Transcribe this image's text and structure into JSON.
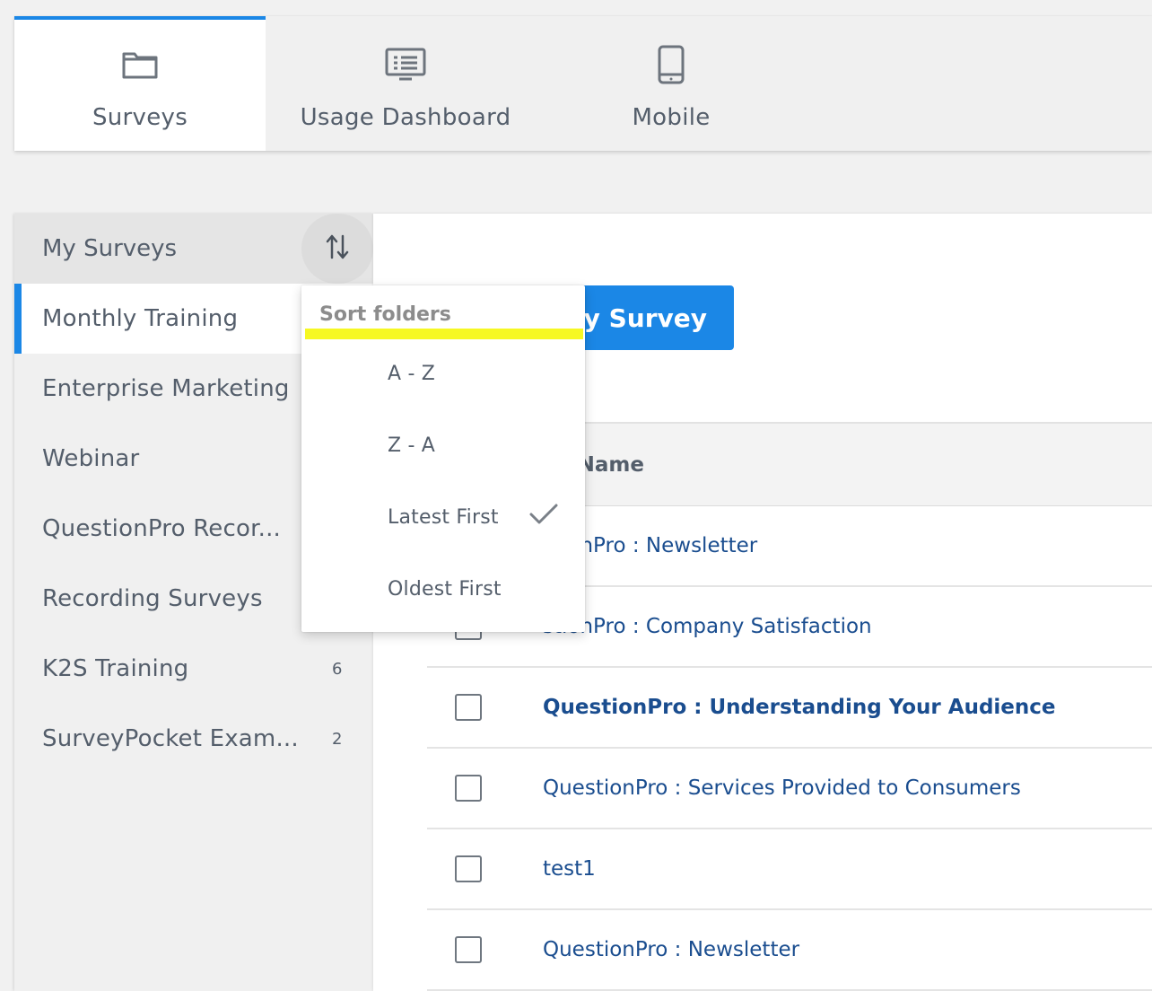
{
  "nav": {
    "tabs": [
      {
        "label": "Surveys",
        "icon": "folder-icon"
      },
      {
        "label": "Usage Dashboard",
        "icon": "dashboard-icon"
      },
      {
        "label": "Mobile",
        "icon": "mobile-icon"
      }
    ]
  },
  "sidebar": {
    "title": "My Surveys",
    "sort_icon": "sort-arrows-icon",
    "items": [
      {
        "name": "Monthly Training",
        "count": ""
      },
      {
        "name": "Enterprise Marketing",
        "count": ""
      },
      {
        "name": "Webinar",
        "count": ""
      },
      {
        "name": "QuestionPro Recor...",
        "count": ""
      },
      {
        "name": "Recording Surveys",
        "count": ""
      },
      {
        "name": "K2S Training",
        "count": "6"
      },
      {
        "name": "SurveyPocket Exam...",
        "count": "2"
      }
    ]
  },
  "main": {
    "create_button": "y Survey",
    "column_header": "ey Name",
    "rows": [
      {
        "name": "stionPro : Newsletter",
        "bold": false
      },
      {
        "name": "stionPro : Company Satisfaction",
        "bold": false
      },
      {
        "name": "QuestionPro : Understanding Your Audience",
        "bold": true
      },
      {
        "name": "QuestionPro : Services Provided to Consumers",
        "bold": false
      },
      {
        "name": "test1",
        "bold": false
      },
      {
        "name": "QuestionPro : Newsletter",
        "bold": false
      }
    ]
  },
  "dropdown": {
    "header": "Sort folders",
    "highlight_color": "#f6f823",
    "options": [
      {
        "label": "A - Z",
        "selected": false
      },
      {
        "label": "Z - A",
        "selected": false
      },
      {
        "label": "Latest First",
        "selected": true
      },
      {
        "label": "Oldest First",
        "selected": false
      }
    ]
  },
  "colors": {
    "accent": "#1b87e6",
    "link": "#1a4d8f",
    "text": "#545e6b"
  }
}
